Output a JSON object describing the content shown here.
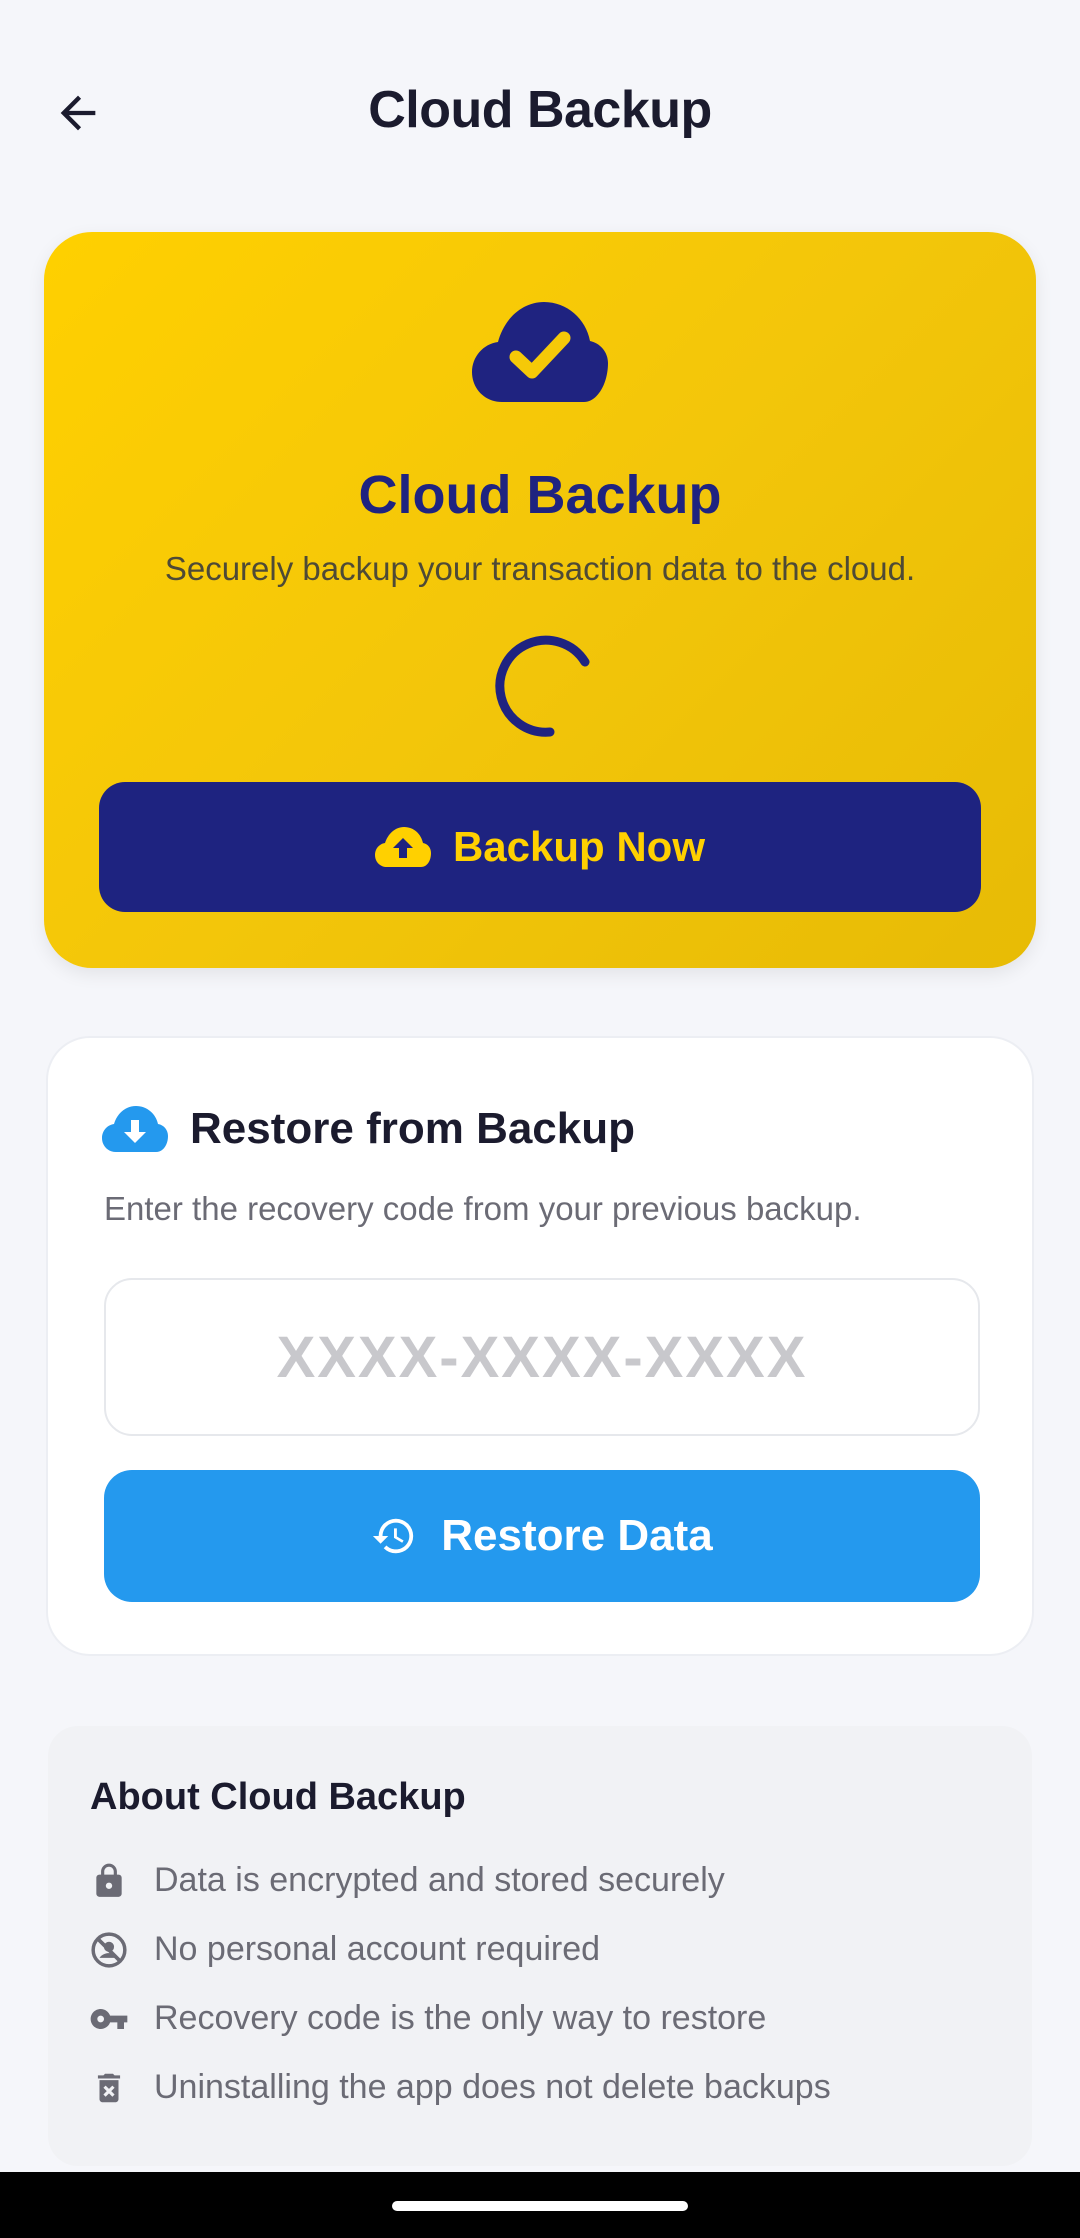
{
  "header": {
    "title": "Cloud Backup",
    "back_icon": "arrow-back-icon"
  },
  "hero": {
    "icon": "cloud-done-icon",
    "title": "Cloud Backup",
    "subtitle": "Securely backup your transaction data to the cloud.",
    "loading": true,
    "button_icon": "cloud-upload-icon",
    "button_label": "Backup Now",
    "colors": {
      "background": "#f5c908",
      "accent": "#1e2380",
      "button_text": "#ffd000"
    }
  },
  "restore": {
    "icon": "cloud-download-icon",
    "title": "Restore from Backup",
    "description": "Enter the recovery code from your previous backup.",
    "input_value": "",
    "input_placeholder": "XXXX-XXXX-XXXX",
    "button_icon": "history-icon",
    "button_label": "Restore Data",
    "colors": {
      "button": "#2499ee"
    }
  },
  "about": {
    "title": "About Cloud Backup",
    "items": [
      {
        "icon": "lock-icon",
        "text": "Data is encrypted and stored securely"
      },
      {
        "icon": "no-account-icon",
        "text": "No personal account required"
      },
      {
        "icon": "key-icon",
        "text": "Recovery code is the only way to restore"
      },
      {
        "icon": "delete-icon",
        "text": "Uninstalling the app does not delete backups"
      }
    ]
  }
}
